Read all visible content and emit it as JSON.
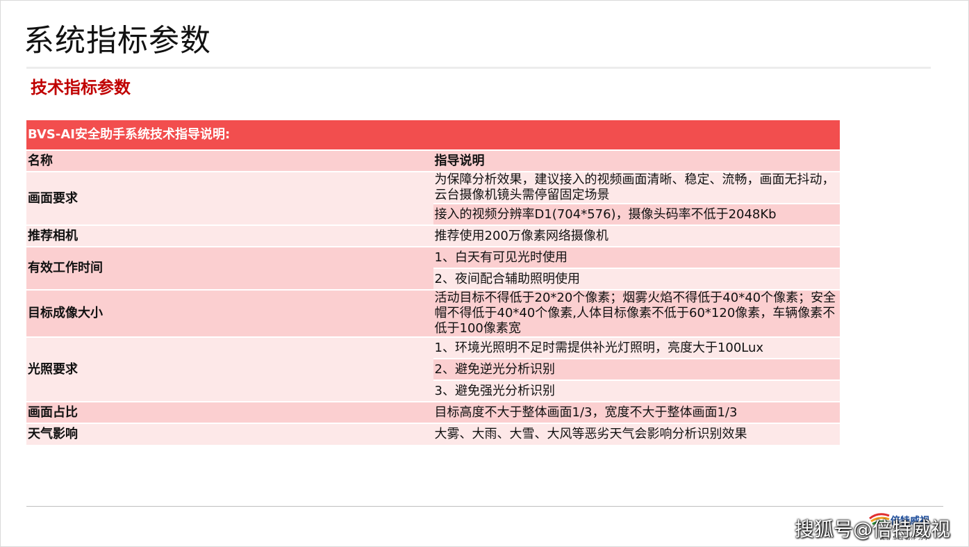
{
  "page": {
    "title": "系统指标参数"
  },
  "section": {
    "heading": "技术指标参数"
  },
  "table": {
    "header": "BVS-AI安全助手系统技术指导说明:",
    "col_name": "名称",
    "col_desc": "指导说明",
    "rows": [
      {
        "name": "画面要求",
        "items": [
          "为保障分析效果，建议接入的视频画面清晰、稳定、流畅，画面无抖动，云台摄像机镜头需停留固定场景",
          "接入的视频分辨率D1(704*576)，摄像头码率不低于2048Kb"
        ]
      },
      {
        "name": "推荐相机",
        "items": [
          "推荐使用200万像素网络摄像机"
        ]
      },
      {
        "name": "有效工作时间",
        "items": [
          "1、白天有可见光时使用",
          "2、夜间配合辅助照明使用"
        ]
      },
      {
        "name": "目标成像大小",
        "items": [
          "活动目标不得低于20*20个像素；烟雾火焰不得低于40*40个像素；安全帽不得低于40*40个像素,人体目标像素不低于60*120像素，车辆像素不低于100像素宽"
        ]
      },
      {
        "name": "光照要求",
        "items": [
          "1、环境光照明不足时需提供补光灯照明，亮度大于100Lux",
          "2、避免逆光分析识别",
          "3、避免强光分析识别"
        ]
      },
      {
        "name": "画面占比",
        "items": [
          "目标高度不大于整体画面1/3，宽度不大于整体画面1/3"
        ]
      },
      {
        "name": "天气影响",
        "items": [
          "大雾、大雨、大雪、大风等恶劣天气会影响分析识别效果"
        ]
      }
    ]
  },
  "footer": {
    "watermark": "搜狐号@倍特威视",
    "logo_name": "倍特威视",
    "logo_slogan": "诚信 卓越 协作 分享"
  },
  "colors": {
    "header_bg": "#f24e4e",
    "row_dark": "#fbcfd0",
    "row_light": "#fde8e8",
    "heading_red": "#c00000"
  }
}
